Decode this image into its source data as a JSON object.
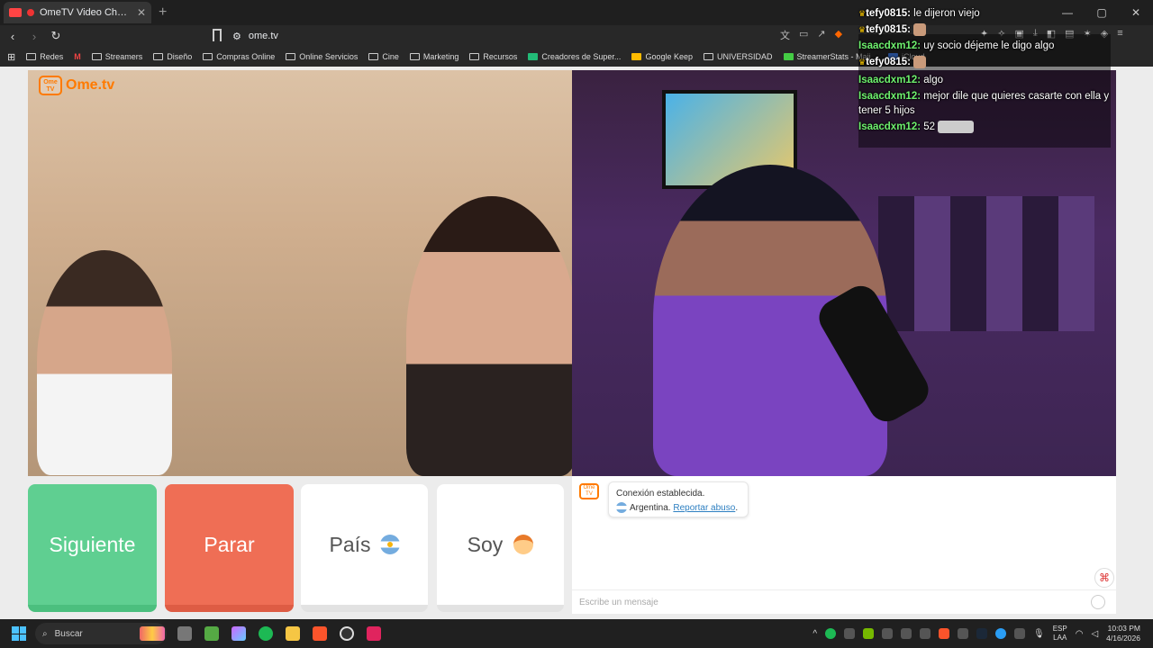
{
  "browser": {
    "tab_title": "OmeTV Video Chat — Omeg",
    "url": "ome.tv",
    "bookmarks": [
      "Redes",
      "Streamers",
      "Diseño",
      "Compras Online",
      "Online Servicios",
      "Cine",
      "Marketing",
      "Recursos",
      "Creadores de Super...",
      "Google Keep",
      "UNIVERSIDAD",
      "StreamerStats - Majj...",
      "iCloud"
    ]
  },
  "app": {
    "logo_text": "Ome.tv",
    "logo_badge": "Ome TV",
    "buttons": {
      "next": "Siguiente",
      "stop": "Parar",
      "country": "País",
      "me": "Soy"
    },
    "chat": {
      "connection_status": "Conexión establecida.",
      "country": "Argentina.",
      "report_link": "Reportar abuso",
      "report_suffix": ".",
      "placeholder": "Escribe un mensaje"
    }
  },
  "overlay_chat": [
    {
      "user": "tefy0815",
      "text": "le dijeron viejo",
      "crown": true,
      "user_color": "white"
    },
    {
      "user": "tefy0815",
      "text": "",
      "crown": true,
      "user_color": "white"
    },
    {
      "user": "Isaacdxm12",
      "text": "uy socio déjeme le digo algo",
      "crown": false,
      "user_color": "green"
    },
    {
      "user": "tefy0815",
      "text": "",
      "crown": true,
      "user_color": "white"
    },
    {
      "user": "Isaacdxm12",
      "text": "algo",
      "crown": false,
      "user_color": "green"
    },
    {
      "user": "Isaacdxm12",
      "text": "mejor dile que quieres casarte con ella y",
      "crown": false,
      "user_color": "green"
    },
    {
      "user": "",
      "text": "tener 5 hijos",
      "crown": false,
      "user_color": "green"
    },
    {
      "user": "Isaacdxm12",
      "text": "52",
      "crown": false,
      "user_color": "green"
    }
  ],
  "taskbar": {
    "search_placeholder": "Buscar",
    "lang_top": "ESP",
    "lang_bottom": "LAA",
    "time": "10:03 PM",
    "date": "4/16/2026"
  }
}
